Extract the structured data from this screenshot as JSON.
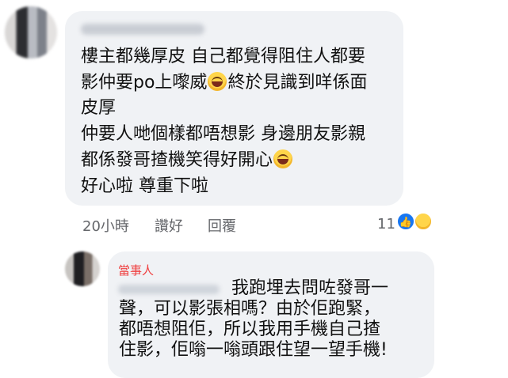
{
  "comment1": {
    "lines": [
      "樓主都幾厚皮 自己都覺得阻住人都要",
      "影仲要po上嚟威",
      "終於見識到咩係面",
      "皮厚",
      "仲要人哋個樣都唔想影 身邊朋友影親",
      "都係發哥揸機笑得好開心",
      "好心啦 尊重下啦"
    ],
    "timestamp": "20小時",
    "like_label": "讚好",
    "reply_label": "回覆",
    "reaction_count": "11"
  },
  "reply": {
    "label": "當事人",
    "lines": [
      "我跑埋去問咗發哥一",
      "聲，可以影張相嗎？由於佢跑緊，",
      "都唔想阻佢，所以我用手機自己揸",
      "住影，佢嗡一嗡頭跟住望一望手機!"
    ]
  },
  "icons": {
    "emoji": "face-with-tears-of-joy",
    "like_reaction": "like-icon",
    "haha_reaction": "haha-icon"
  },
  "colors": {
    "bubble": "#f0f2f5",
    "meta_text": "#65676b",
    "like_blue": "#1877f2",
    "label_red": "#ef3f3f"
  }
}
